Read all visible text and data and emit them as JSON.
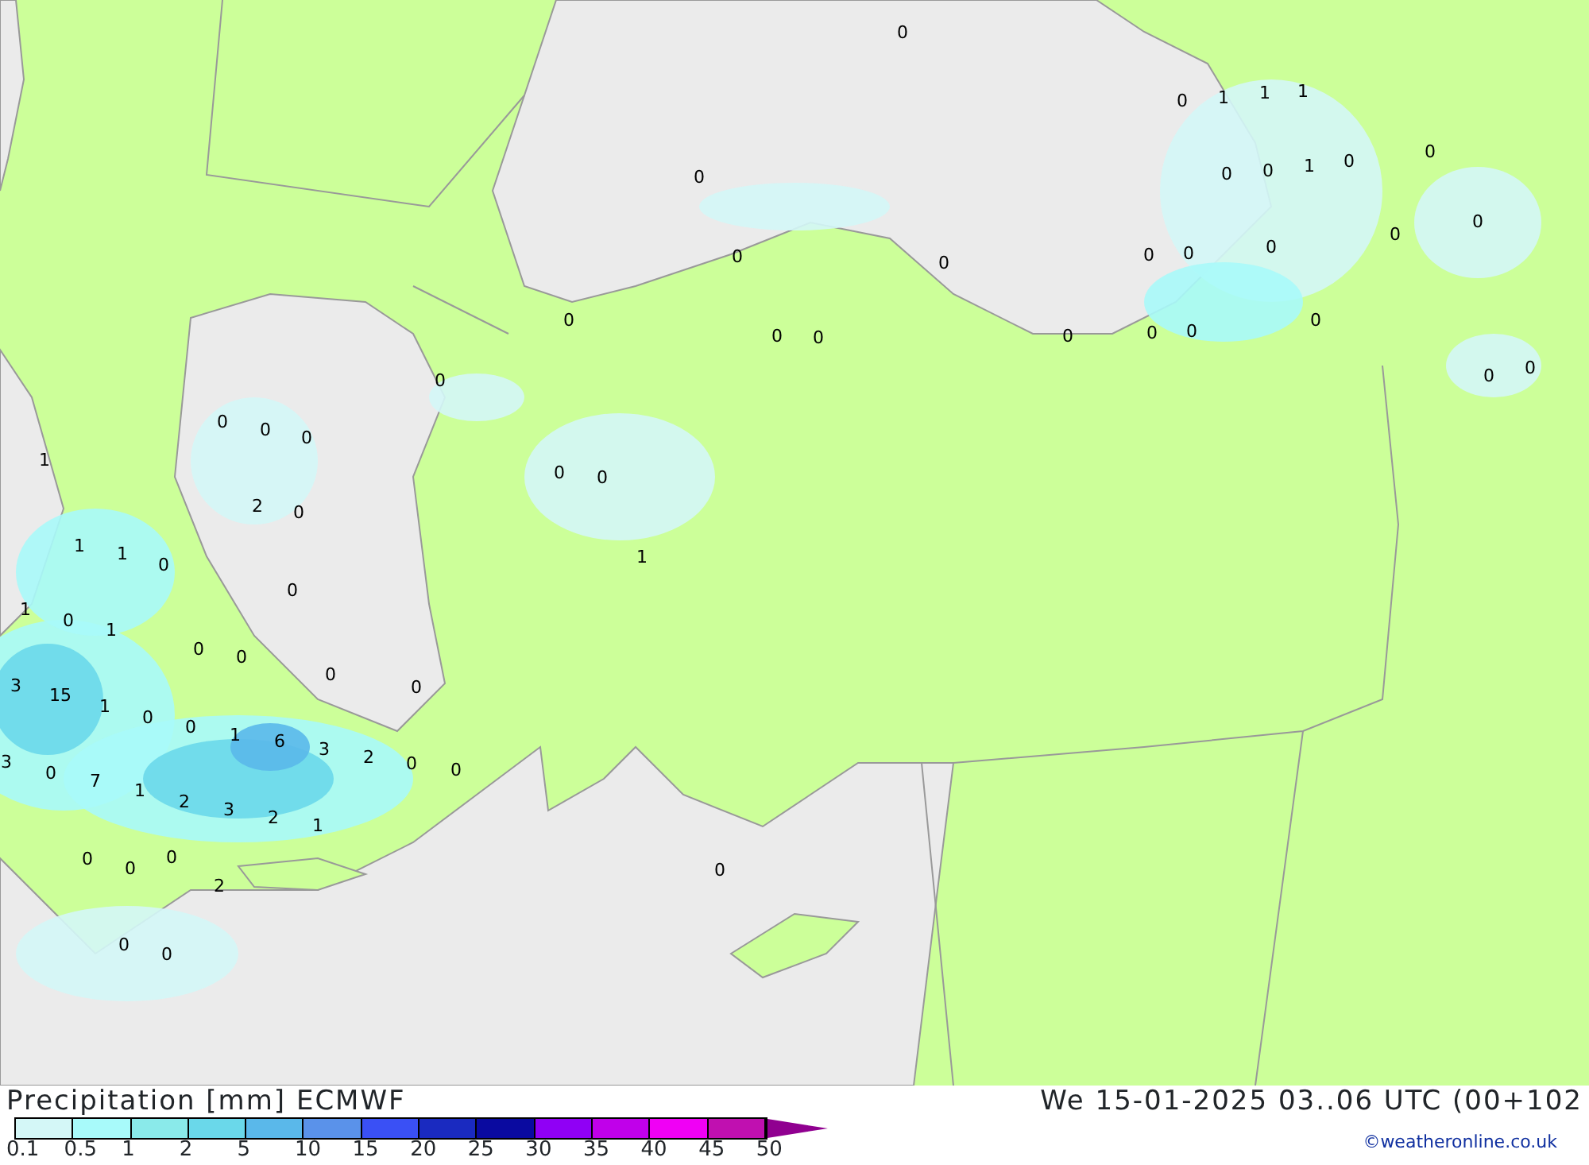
{
  "map": {
    "labels": [
      "0",
      "0",
      "1",
      "1",
      "1",
      "0",
      "0",
      "0",
      "1",
      "0",
      "0",
      "0",
      "0",
      "0",
      "0",
      "0",
      "0",
      "0",
      "0",
      "0",
      "0",
      "0",
      "0",
      "0",
      "0",
      "0",
      "0",
      "0",
      "0",
      "0",
      "0",
      "1",
      "0",
      "0",
      "2",
      "0",
      "1",
      "1",
      "0",
      "1",
      "0",
      "1",
      "0",
      "1",
      "0",
      "0",
      "3",
      "15",
      "1",
      "0",
      "0",
      "0",
      "0",
      "1",
      "6",
      "3",
      "2",
      "0",
      "0",
      "3",
      "0",
      "7",
      "1",
      "2",
      "3",
      "2",
      "1",
      "0",
      "0",
      "0",
      "2",
      "0",
      "0",
      "0"
    ]
  },
  "footer": {
    "title": "Precipitation [mm] ECMWF",
    "datetime": "We 15-01-2025 03..06 UTC (00+102",
    "credit": "©weatheronline.co.uk",
    "legend": [
      {
        "color": "#d4f7f7"
      },
      {
        "color": "#a8fafa"
      },
      {
        "color": "#8aeaea"
      },
      {
        "color": "#6ad8ea"
      },
      {
        "color": "#5ab8ea"
      },
      {
        "color": "#5a92ea"
      },
      {
        "color": "#3a50f5"
      },
      {
        "color": "#1a2ac0"
      },
      {
        "color": "#0a0aa0"
      },
      {
        "color": "#9000f5"
      },
      {
        "color": "#c000ea"
      },
      {
        "color": "#f000f5"
      },
      {
        "color": "#c010b0"
      }
    ],
    "legend_labels": [
      "0.1",
      "0.5",
      "1",
      "2",
      "5",
      "10",
      "15",
      "20",
      "25",
      "30",
      "35",
      "40",
      "45",
      "50"
    ]
  }
}
